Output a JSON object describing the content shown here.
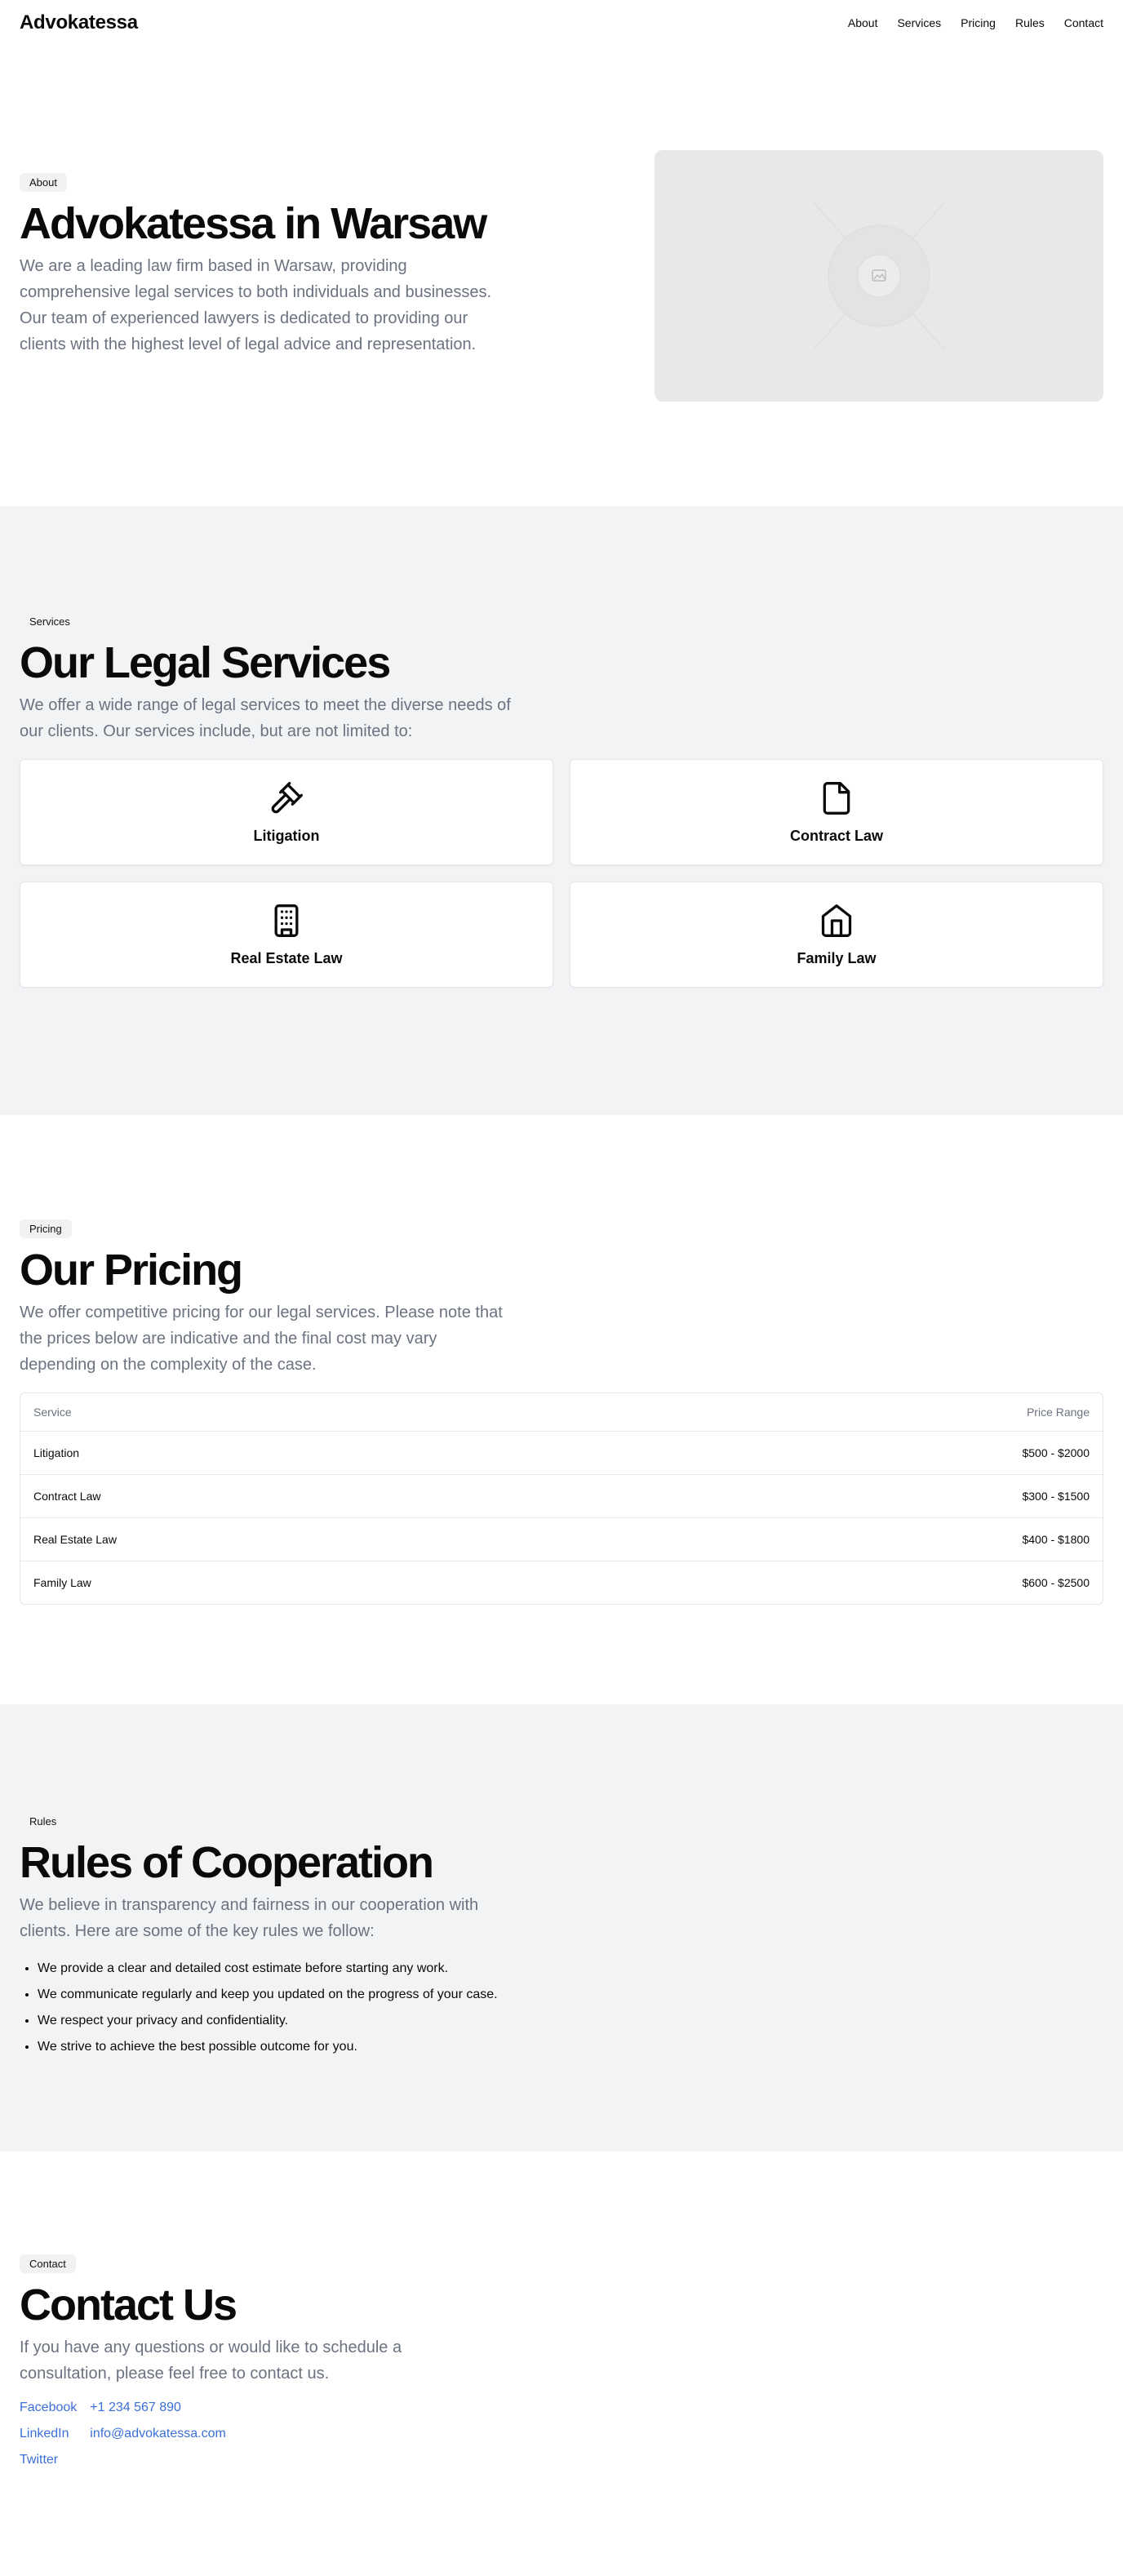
{
  "header": {
    "brand": "Advokatessa",
    "nav": [
      "About",
      "Services",
      "Pricing",
      "Rules",
      "Contact"
    ]
  },
  "about": {
    "badge": "About",
    "title": "Advokatessa in Warsaw",
    "text": "We are a leading law firm based in Warsaw, providing comprehensive legal services to both individuals and businesses. Our team of experienced lawyers is dedicated to providing our clients with the highest level of legal advice and representation.",
    "image_icon": "image-placeholder-icon"
  },
  "services": {
    "badge": "Services",
    "title": "Our Legal Services",
    "text": "We offer a wide range of legal services to meet the diverse needs of our clients. Our services include, but are not limited to:",
    "items": [
      {
        "label": "Litigation",
        "icon": "gavel-icon"
      },
      {
        "label": "Contract Law",
        "icon": "file-icon"
      },
      {
        "label": "Real Estate Law",
        "icon": "building-icon"
      },
      {
        "label": "Family Law",
        "icon": "home-icon"
      }
    ]
  },
  "pricing": {
    "badge": "Pricing",
    "title": "Our Pricing",
    "text": "We offer competitive pricing for our legal services. Please note that the prices below are indicative and the final cost may vary depending on the complexity of the case.",
    "columns": [
      "Service",
      "Price Range"
    ],
    "rows": [
      [
        "Litigation",
        "$500 - $2000"
      ],
      [
        "Contract Law",
        "$300 - $1500"
      ],
      [
        "Real Estate Law",
        "$400 - $1800"
      ],
      [
        "Family Law",
        "$600 - $2500"
      ]
    ]
  },
  "rules": {
    "badge": "Rules",
    "title": "Rules of Cooperation",
    "text": "We believe in transparency and fairness in our cooperation with clients. Here are some of the key rules we follow:",
    "items": [
      "We provide a clear and detailed cost estimate before starting any work.",
      "We communicate regularly and keep you updated on the progress of your case.",
      "We respect your privacy and confidentiality.",
      "We strive to achieve the best possible outcome for you."
    ]
  },
  "contact": {
    "badge": "Contact",
    "title": "Contact Us",
    "text": "If you have any questions or would like to schedule a consultation, please feel free to contact us.",
    "social": [
      "Facebook",
      "LinkedIn",
      "Twitter"
    ],
    "details": [
      "+1 234 567 890",
      "info@advokatessa.com"
    ]
  },
  "colors": {
    "link": "#3b6fd8",
    "muted_text": "#6b7280",
    "section_grey": "#f2f3f5"
  }
}
